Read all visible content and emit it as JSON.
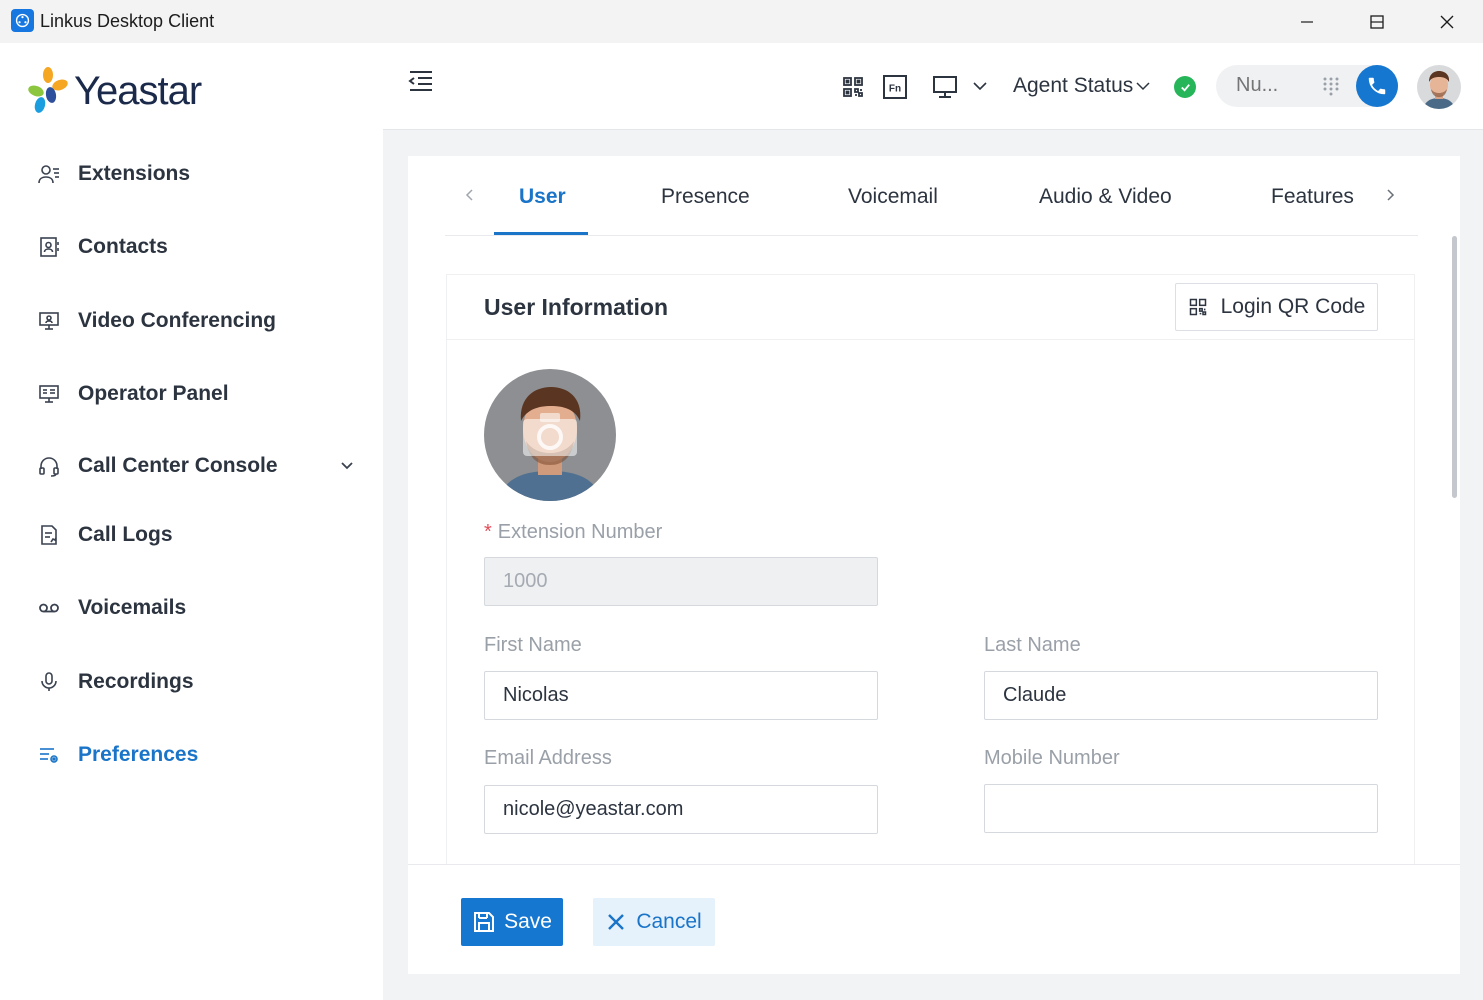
{
  "window": {
    "title": "Linkus Desktop Client",
    "controls": [
      "minimize",
      "maximize",
      "close"
    ]
  },
  "sidebar": {
    "logo_text": "Yeastar",
    "items": [
      {
        "label": "Extensions",
        "icon": "extensions-icon"
      },
      {
        "label": "Contacts",
        "icon": "contacts-icon"
      },
      {
        "label": "Video Conferencing",
        "icon": "video-conferencing-icon"
      },
      {
        "label": "Operator Panel",
        "icon": "operator-panel-icon"
      },
      {
        "label": "Call Center Console",
        "icon": "headset-icon",
        "expandable": true
      },
      {
        "label": "Call Logs",
        "icon": "call-logs-icon"
      },
      {
        "label": "Voicemails",
        "icon": "voicemail-icon"
      },
      {
        "label": "Recordings",
        "icon": "microphone-icon"
      },
      {
        "label": "Preferences",
        "icon": "preferences-icon",
        "active": true
      }
    ]
  },
  "header": {
    "agent_status_label": "Agent Status",
    "agent_status_color": "#27b55a",
    "dial_placeholder": "Nu..."
  },
  "tabs": {
    "items": [
      "User",
      "Presence",
      "Voicemail",
      "Audio & Video",
      "Features"
    ],
    "active": "User"
  },
  "user_info": {
    "title": "User Information",
    "qr_button_label": "Login QR Code",
    "extension_number": {
      "label": "Extension Number",
      "value": "1000",
      "required": true,
      "disabled": true
    },
    "first_name": {
      "label": "First Name",
      "value": "Nicolas"
    },
    "last_name": {
      "label": "Last Name",
      "value": "Claude"
    },
    "email": {
      "label": "Email Address",
      "value": "nicole@yeastar.com"
    },
    "mobile": {
      "label": "Mobile Number",
      "value": ""
    }
  },
  "footer": {
    "save_label": "Save",
    "cancel_label": "Cancel"
  },
  "colors": {
    "accent": "#1677d0",
    "active_nav": "#1a74c8",
    "status_online": "#27b55a"
  }
}
